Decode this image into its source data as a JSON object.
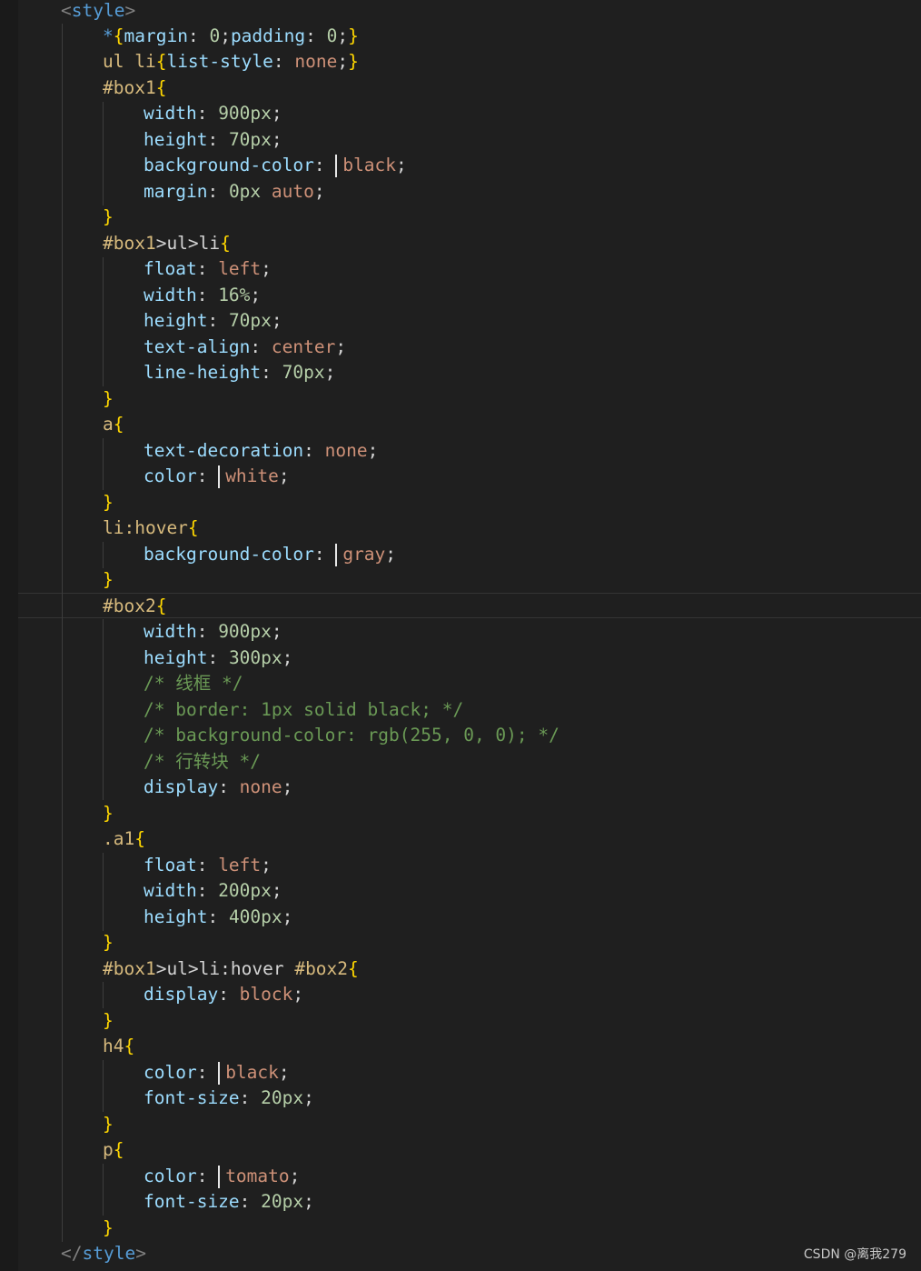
{
  "code": {
    "l00": {
      "a": "<",
      "b": "style",
      "c": ">"
    },
    "l01": {
      "a": "*",
      "b": "{",
      "c": "margin",
      "d": ": ",
      "e": "0",
      "f": ";",
      "g": "padding",
      "h": ": ",
      "i": "0",
      "j": ";",
      "k": "}"
    },
    "l02": {
      "a": "ul li",
      "b": "{",
      "c": "list-style",
      "d": ": ",
      "e": "none",
      "f": ";",
      "g": "}"
    },
    "l03": {
      "a": "#box1",
      "b": "{"
    },
    "l04": {
      "a": "width",
      "b": ": ",
      "c": "900px",
      "d": ";"
    },
    "l05": {
      "a": "height",
      "b": ": ",
      "c": "70px",
      "d": ";"
    },
    "l06": {
      "a": "background-color",
      "b": ": ",
      "c": "black",
      "d": ";",
      "swatch": "#000000"
    },
    "l07": {
      "a": "margin",
      "b": ": ",
      "c": "0px",
      "d": " ",
      "e": "auto",
      "f": ";"
    },
    "l08": {
      "a": "}"
    },
    "l09": {
      "a": "#box1",
      "b": ">ul>li",
      "c": "{"
    },
    "l10": {
      "a": "float",
      "b": ": ",
      "c": "left",
      "d": ";"
    },
    "l11": {
      "a": "width",
      "b": ": ",
      "c": "16%",
      "d": ";"
    },
    "l12": {
      "a": "height",
      "b": ": ",
      "c": "70px",
      "d": ";"
    },
    "l13": {
      "a": "text-align",
      "b": ": ",
      "c": "center",
      "d": ";"
    },
    "l14": {
      "a": "line-height",
      "b": ": ",
      "c": "70px",
      "d": ";"
    },
    "l15": {
      "a": "}"
    },
    "l16": {
      "a": "a",
      "b": "{"
    },
    "l17": {
      "a": "text-decoration",
      "b": ": ",
      "c": "none",
      "d": ";"
    },
    "l18": {
      "a": "color",
      "b": ": ",
      "c": "white",
      "d": ";",
      "swatch": "#ffffff"
    },
    "l19": {
      "a": "}"
    },
    "l20": {
      "a": "li:hover",
      "b": "{"
    },
    "l21": {
      "a": "background-color",
      "b": ": ",
      "c": "gray",
      "d": ";",
      "swatch": "#808080"
    },
    "l22": {
      "a": "}"
    },
    "l23": {
      "a": "#box2",
      "b": "{"
    },
    "l24": {
      "a": "width",
      "b": ": ",
      "c": "900px",
      "d": ";"
    },
    "l25": {
      "a": "height",
      "b": ": ",
      "c": "300px",
      "d": ";"
    },
    "l26": {
      "a": "/* 线框 */"
    },
    "l27": {
      "a": "/* border: 1px solid black; */"
    },
    "l28": {
      "a": "/* background-color: rgb(255, 0, 0); */"
    },
    "l29": {
      "a": "/* 行转块 */"
    },
    "l30": {
      "a": "display",
      "b": ": ",
      "c": "none",
      "d": ";"
    },
    "l31": {
      "a": "}"
    },
    "l32": {
      "a": ".a1",
      "b": "{"
    },
    "l33": {
      "a": "float",
      "b": ": ",
      "c": "left",
      "d": ";"
    },
    "l34": {
      "a": "width",
      "b": ": ",
      "c": "200px",
      "d": ";"
    },
    "l35": {
      "a": "height",
      "b": ": ",
      "c": "400px",
      "d": ";"
    },
    "l36": {
      "a": "}"
    },
    "l37": {
      "a": "#box1",
      "b": ">ul>li:hover ",
      "c": "#box2",
      "d": "{"
    },
    "l38": {
      "a": "display",
      "b": ": ",
      "c": "block",
      "d": ";"
    },
    "l39": {
      "a": "}"
    },
    "l40": {
      "a": "h4",
      "b": "{"
    },
    "l41": {
      "a": "color",
      "b": ": ",
      "c": "black",
      "d": ";",
      "swatch": "#000000"
    },
    "l42": {
      "a": "font-size",
      "b": ": ",
      "c": "20px",
      "d": ";"
    },
    "l43": {
      "a": "}"
    },
    "l44": {
      "a": "p",
      "b": "{"
    },
    "l45": {
      "a": "color",
      "b": ": ",
      "c": "tomato",
      "d": ";",
      "swatch": "#ff6347"
    },
    "l46": {
      "a": "font-size",
      "b": ": ",
      "c": "20px",
      "d": ";"
    },
    "l47": {
      "a": "}"
    },
    "l48": {
      "a": "</",
      "b": "style",
      "c": ">"
    }
  },
  "watermark": "CSDN @离我279"
}
